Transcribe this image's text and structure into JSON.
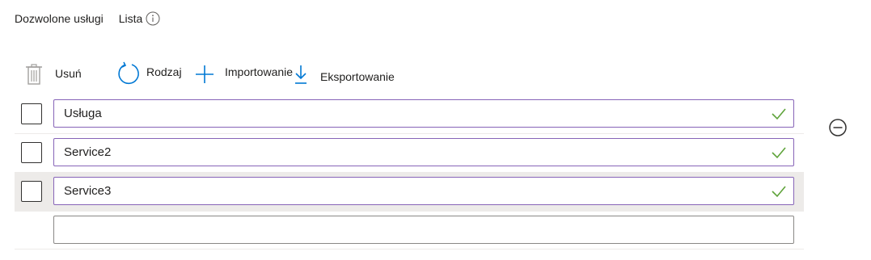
{
  "header": {
    "title": "Dozwolone usługi",
    "list_label": "Lista"
  },
  "toolbar": {
    "delete_label": "Usuń",
    "sort_label": "Rodzaj",
    "import_label": "Importowanie",
    "export_label": "Eksportowanie"
  },
  "services": [
    {
      "value": "Usługa",
      "valid": true
    },
    {
      "value": "Service2",
      "valid": true
    },
    {
      "value": "Service3",
      "valid": true,
      "selected": true
    }
  ],
  "new_entry": {
    "value": ""
  },
  "colors": {
    "accent": "#8764b8",
    "check": "#5ea33a",
    "selected_row": "#edebe9",
    "sort_icon": "#0078d4"
  },
  "icons": {
    "info": "info-icon",
    "delete": "trash-icon",
    "sort": "refresh-icon",
    "import": "plus-icon",
    "export": "download-icon",
    "valid": "checkmark-icon",
    "remove": "minus-circle-icon"
  }
}
